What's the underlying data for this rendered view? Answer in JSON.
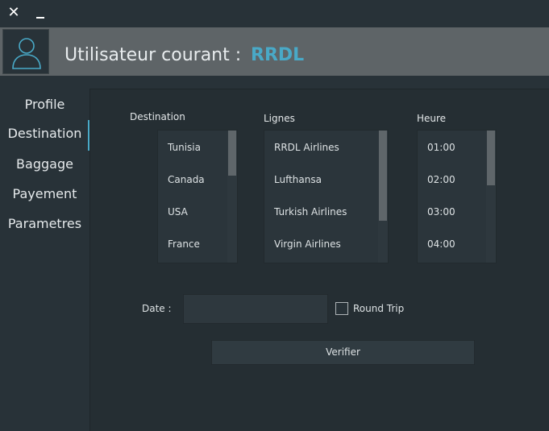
{
  "window": {
    "close_glyph": "✕"
  },
  "header": {
    "user_label": "Utilisateur courant :",
    "user_name": "RRDL",
    "accent_color": "#49a9c7"
  },
  "sidebar": {
    "active": "Destination",
    "items": [
      {
        "label": "Profile"
      },
      {
        "label": "Destination"
      },
      {
        "label": "Baggage"
      },
      {
        "label": "Payement"
      },
      {
        "label": "Parametres"
      }
    ]
  },
  "main": {
    "columns": {
      "destination": {
        "header": "Destination",
        "items": [
          "Tunisia",
          "Canada",
          "USA",
          "France"
        ]
      },
      "lignes": {
        "header": "Lignes",
        "items": [
          "RRDL Airlines",
          "Lufthansa",
          "Turkish Airlines",
          "Virgin Airlines"
        ]
      },
      "heure": {
        "header": "Heure",
        "items": [
          "01:00",
          "02:00",
          "03:00",
          "04:00"
        ]
      }
    },
    "date": {
      "label": "Date :",
      "value": ""
    },
    "round_trip": {
      "label": "Round Trip",
      "checked": false
    },
    "verify_button": "Verifier"
  }
}
